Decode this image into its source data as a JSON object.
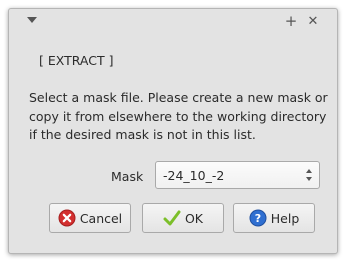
{
  "titlebar": {
    "menu_icon": "chevron-down-icon",
    "maximize_glyph": "+",
    "close_glyph": "✕"
  },
  "dialog": {
    "section_title": "[ EXTRACT ]",
    "message": "Select a mask file. Please create a new mask or copy it from elsewhere to the working directory if the desired mask is not in this list.",
    "mask_label": "Mask",
    "mask_value": "-24_10_-2"
  },
  "buttons": {
    "cancel_label": "Cancel",
    "ok_label": "OK",
    "help_label": "Help"
  },
  "colors": {
    "window_bg": "#e3e3e3",
    "cancel_icon": "#d32f2f",
    "ok_icon": "#7cbf2a",
    "help_icon": "#2f6fd1"
  }
}
